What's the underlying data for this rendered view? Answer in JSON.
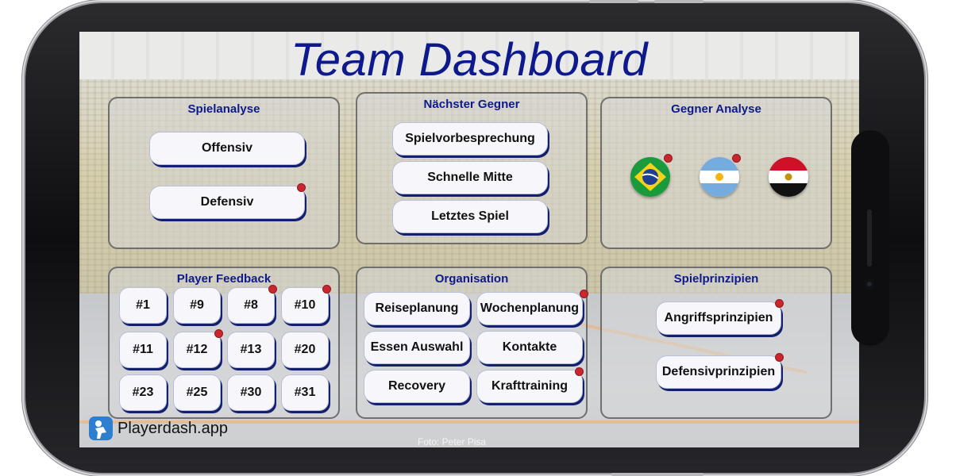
{
  "app": {
    "title": "Team Dashboard",
    "brand": "Playerdash.app",
    "photo_credit": "Foto: Peter Pisa",
    "colors": {
      "title": "#0e1a8c",
      "badge": "#c9262e",
      "button_shadow": "#13206e"
    }
  },
  "spielanalyse": {
    "title": "Spielanalyse",
    "buttons": [
      {
        "label": "Offensiv",
        "badge": false
      },
      {
        "label": "Defensiv",
        "badge": true
      }
    ]
  },
  "naechster_gegner": {
    "title": "Nächster Gegner",
    "buttons": [
      {
        "label": "Spielvorbesprechung",
        "badge": false
      },
      {
        "label": "Schnelle Mitte",
        "badge": false
      },
      {
        "label": "Letztes Spiel",
        "badge": false
      }
    ]
  },
  "gegner_analyse": {
    "title": "Gegner Analyse",
    "flags": [
      {
        "icon": "brazil-flag-icon",
        "badge": true
      },
      {
        "icon": "argentina-flag-icon",
        "badge": true
      },
      {
        "icon": "egypt-flag-icon",
        "badge": false
      }
    ]
  },
  "player_feedback": {
    "title": "Player Feedback",
    "players": [
      {
        "label": "#1",
        "badge": false
      },
      {
        "label": "#9",
        "badge": false
      },
      {
        "label": "#8",
        "badge": true
      },
      {
        "label": "#10",
        "badge": true
      },
      {
        "label": "#11",
        "badge": false
      },
      {
        "label": "#12",
        "badge": true
      },
      {
        "label": "#13",
        "badge": false
      },
      {
        "label": "#20",
        "badge": false
      },
      {
        "label": "#23",
        "badge": false
      },
      {
        "label": "#25",
        "badge": false
      },
      {
        "label": "#30",
        "badge": false
      },
      {
        "label": "#31",
        "badge": false
      }
    ]
  },
  "organisation": {
    "title": "Organisation",
    "buttons": [
      {
        "label": "Reiseplanung",
        "badge": false
      },
      {
        "label": "Wochenplanung",
        "badge": true
      },
      {
        "label": "Essen Auswahl",
        "badge": false
      },
      {
        "label": "Kontakte",
        "badge": false
      },
      {
        "label": "Recovery",
        "badge": false
      },
      {
        "label": "Krafttraining",
        "badge": true
      }
    ]
  },
  "spielprinzipien": {
    "title": "Spielprinzipien",
    "buttons": [
      {
        "label": "Angriffsprinzipien",
        "badge": true
      },
      {
        "label": "Defensivprinzipien",
        "badge": true
      }
    ]
  }
}
